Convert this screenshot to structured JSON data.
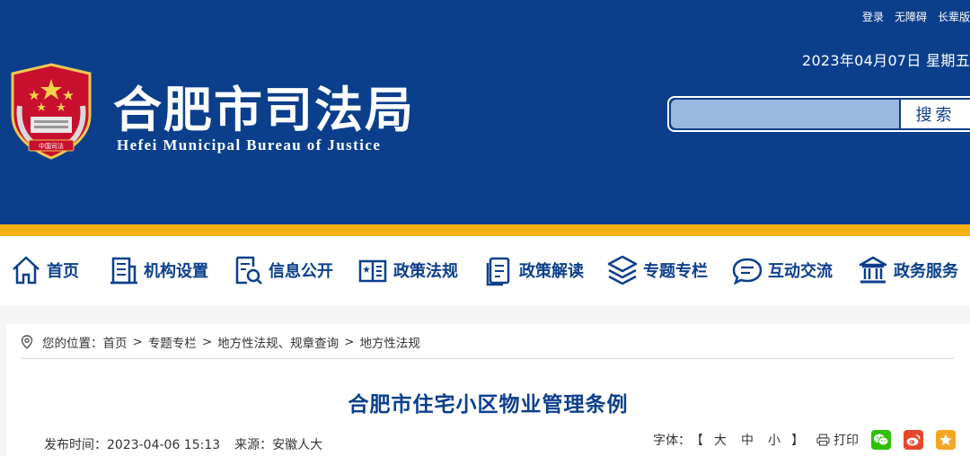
{
  "top_links": [
    "登录",
    "无障碍",
    "长辈版"
  ],
  "date": "2023年04月07日 星期五",
  "site": {
    "title_cn": "合肥市司法局",
    "title_en": "Hefei Municipal Bureau of Justice",
    "emblem_text": "中国司法"
  },
  "search": {
    "placeholder": "",
    "button": "搜索"
  },
  "nav": [
    {
      "label": "首页",
      "icon": "home-icon"
    },
    {
      "label": "机构设置",
      "icon": "building-icon"
    },
    {
      "label": "信息公开",
      "icon": "document-search-icon"
    },
    {
      "label": "政策法规",
      "icon": "book-icon"
    },
    {
      "label": "政策解读",
      "icon": "clipboard-icon"
    },
    {
      "label": "专题专栏",
      "icon": "layers-icon"
    },
    {
      "label": "互动交流",
      "icon": "chat-icon"
    },
    {
      "label": "政务服务",
      "icon": "government-icon"
    }
  ],
  "breadcrumb": {
    "prefix": "您的位置：",
    "items": [
      "首页",
      "专题专栏",
      "地方性法规、规章查询",
      "地方性法规"
    ],
    "separator": ">"
  },
  "article": {
    "title": "合肥市住宅小区物业管理条例",
    "publish_label": "发布时间：",
    "publish_time": "2023-04-06 15:13",
    "source_label": "来源：",
    "source": "安徽人大"
  },
  "tools": {
    "font_label": "字体：",
    "bracket_open": "【",
    "bracket_close": "】",
    "sizes": [
      "大",
      "中",
      "小"
    ],
    "print": "打印"
  },
  "colors": {
    "brand_blue": "#0b3f8c",
    "gold": "#f5b013",
    "wechat": "#2dc100",
    "weibo": "#e6462c",
    "favorite": "#f5a623"
  }
}
